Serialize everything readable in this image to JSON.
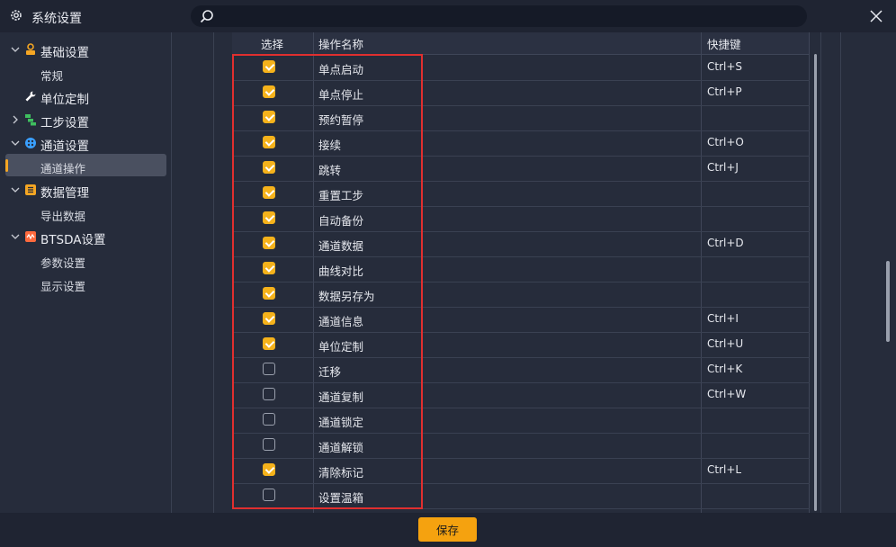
{
  "window": {
    "title": "系统设置"
  },
  "search": {
    "placeholder": ""
  },
  "sidebar": {
    "items": [
      {
        "type": "category",
        "label": "基础设置",
        "expanded": true,
        "icon": "badge-icon",
        "icon_color": "#f5a623"
      },
      {
        "type": "sub",
        "label": "常规"
      },
      {
        "type": "category-noarrow",
        "label": "单位定制",
        "icon": "wrench-icon",
        "icon_color": "#ffffff"
      },
      {
        "type": "category",
        "label": "工步设置",
        "expanded": false,
        "icon": "steps-icon",
        "icon_color": "#3fbf5f"
      },
      {
        "type": "category",
        "label": "通道设置",
        "expanded": true,
        "icon": "channel-icon",
        "icon_color": "#3aa0ff"
      },
      {
        "type": "sub",
        "label": "通道操作",
        "active": true
      },
      {
        "type": "category",
        "label": "数据管理",
        "expanded": true,
        "icon": "list-icon",
        "icon_color": "#f5a623"
      },
      {
        "type": "sub",
        "label": "导出数据"
      },
      {
        "type": "category",
        "label": "BTSDA设置",
        "expanded": true,
        "icon": "wave-icon",
        "icon_color": "#ff6a3d"
      },
      {
        "type": "sub",
        "label": "参数设置"
      },
      {
        "type": "sub",
        "label": "显示设置"
      }
    ]
  },
  "table": {
    "headers": {
      "select": "选择",
      "name": "操作名称",
      "hotkey": "快捷键"
    },
    "rows": [
      {
        "checked": true,
        "name": "单点启动",
        "hotkey": "Ctrl+S"
      },
      {
        "checked": true,
        "name": "单点停止",
        "hotkey": "Ctrl+P"
      },
      {
        "checked": true,
        "name": "预约暂停",
        "hotkey": ""
      },
      {
        "checked": true,
        "name": "接续",
        "hotkey": "Ctrl+O"
      },
      {
        "checked": true,
        "name": "跳转",
        "hotkey": "Ctrl+J"
      },
      {
        "checked": true,
        "name": "重置工步",
        "hotkey": ""
      },
      {
        "checked": true,
        "name": "自动备份",
        "hotkey": ""
      },
      {
        "checked": true,
        "name": "通道数据",
        "hotkey": "Ctrl+D"
      },
      {
        "checked": true,
        "name": "曲线对比",
        "hotkey": ""
      },
      {
        "checked": true,
        "name": "数据另存为",
        "hotkey": ""
      },
      {
        "checked": true,
        "name": "通道信息",
        "hotkey": "Ctrl+I"
      },
      {
        "checked": true,
        "name": "单位定制",
        "hotkey": "Ctrl+U"
      },
      {
        "checked": false,
        "name": "迁移",
        "hotkey": "Ctrl+K"
      },
      {
        "checked": false,
        "name": "通道复制",
        "hotkey": "Ctrl+W"
      },
      {
        "checked": false,
        "name": "通道锁定",
        "hotkey": ""
      },
      {
        "checked": false,
        "name": "通道解锁",
        "hotkey": ""
      },
      {
        "checked": true,
        "name": "清除标记",
        "hotkey": "Ctrl+L"
      },
      {
        "checked": false,
        "name": "设置温箱",
        "hotkey": ""
      }
    ]
  },
  "footer": {
    "save_label": "保存"
  },
  "colors": {
    "accent": "#f5a20f",
    "highlight": "#e02f2f"
  }
}
